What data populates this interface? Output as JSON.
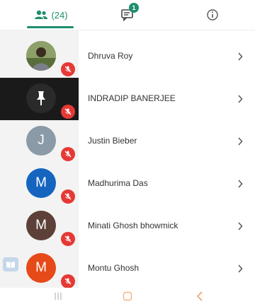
{
  "tabs": {
    "participants_count": "(24)",
    "chat_badge": "1",
    "active_color": "#1e8e6e"
  },
  "participants": [
    {
      "name": "Dhruva Roy",
      "avatar": "photo",
      "muted": true
    },
    {
      "name": "INDRADIP BANERJEE",
      "avatar": "pin-icon",
      "muted": true,
      "selected": true
    },
    {
      "name": "Justin Bieber",
      "avatar": "J",
      "avatar_color": "#8a9aa6",
      "muted": true
    },
    {
      "name": "Madhurima Das",
      "avatar": "M",
      "avatar_color": "#1565c0",
      "muted": true
    },
    {
      "name": "Minati Ghosh bhowmick",
      "avatar": "M",
      "avatar_color": "#5d4037",
      "muted": true
    },
    {
      "name": "Montu Ghosh",
      "avatar": "M",
      "avatar_color": "#e64a19",
      "muted": true
    }
  ],
  "icons": {
    "mute": "mic-off-icon",
    "chevron": "chevron-right-icon",
    "nav": [
      "recent-apps-icon",
      "home-icon",
      "back-icon"
    ]
  }
}
